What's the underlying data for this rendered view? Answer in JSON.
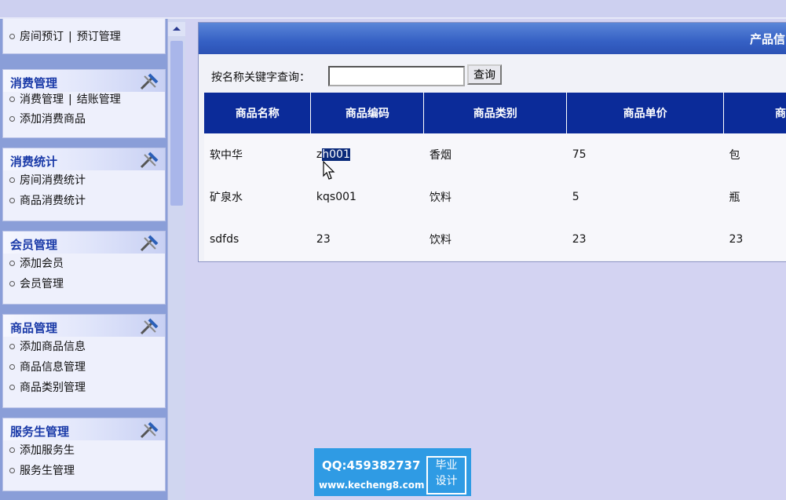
{
  "sidebar": {
    "panels": [
      {
        "title": "",
        "items": [
          {
            "label": "房间预订",
            "label2": "预订管理"
          }
        ]
      },
      {
        "title": "消费管理",
        "items": [
          {
            "label": "消费管理",
            "label2": "结账管理"
          },
          {
            "label": "添加消费商品"
          }
        ]
      },
      {
        "title": "消费统计",
        "items": [
          {
            "label": "房间消费统计"
          },
          {
            "label": "商品消费统计"
          }
        ]
      },
      {
        "title": "会员管理",
        "items": [
          {
            "label": "添加会员"
          },
          {
            "label": "会员管理"
          }
        ]
      },
      {
        "title": "商品管理",
        "items": [
          {
            "label": "添加商品信息"
          },
          {
            "label": "商品信息管理"
          },
          {
            "label": "商品类别管理"
          }
        ]
      },
      {
        "title": "服务生管理",
        "items": [
          {
            "label": "添加服务生"
          },
          {
            "label": "服务生管理"
          }
        ]
      }
    ],
    "separator": "|"
  },
  "main": {
    "header_title": "产品信",
    "search": {
      "label": "按名称关键字查询：",
      "value": "",
      "button": "查询"
    },
    "table": {
      "columns": [
        "商品名称",
        "商品编码",
        "商品类别",
        "商品单价",
        "商"
      ],
      "rows": [
        [
          "软中华",
          "zh001",
          "香烟",
          "75",
          "包"
        ],
        [
          "矿泉水",
          "kqs001",
          "饮料",
          "5",
          "瓶"
        ],
        [
          "sdfds",
          "23",
          "饮料",
          "23",
          "23"
        ]
      ],
      "selected_text": {
        "prefix": "z",
        "highlight": "h001"
      }
    }
  },
  "watermark": {
    "line1": "QQ:459382737",
    "line2": "www.kecheng8.com",
    "badge1": "毕业",
    "badge2": "设计"
  }
}
